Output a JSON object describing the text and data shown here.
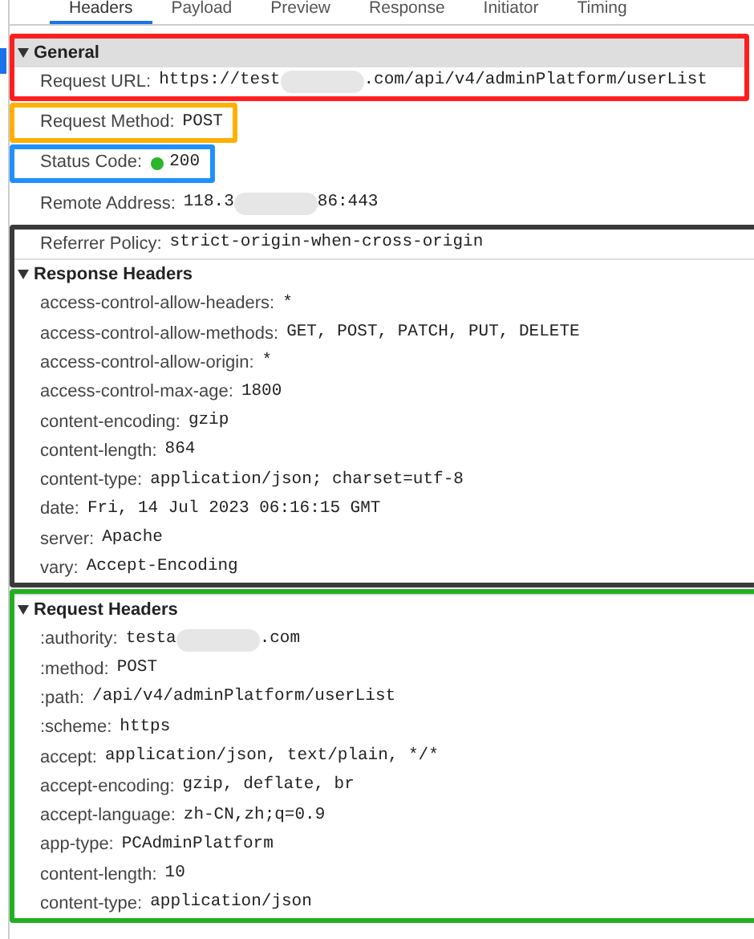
{
  "tabs": [
    {
      "label": "Headers",
      "selected": true
    },
    {
      "label": "Payload",
      "selected": false
    },
    {
      "label": "Preview",
      "selected": false
    },
    {
      "label": "Response",
      "selected": false
    },
    {
      "label": "Initiator",
      "selected": false
    },
    {
      "label": "Timing",
      "selected": false
    }
  ],
  "blocks": [
    {
      "color": "#ff1f1f",
      "lines": [
        {
          "kind": "section",
          "title": "General",
          "expanded": true,
          "highlighted": true
        },
        {
          "kind": "header",
          "name": "Request URL:",
          "value": "https://test",
          "redacted": true,
          "value_after": ".com/api/v4/adminPlatform/userList"
        }
      ]
    },
    {
      "color": "#ffb000",
      "lines": [
        {
          "kind": "header",
          "name": "Request Method:",
          "value": "POST"
        }
      ]
    },
    {
      "color": "#1e90ff",
      "lines": [
        {
          "kind": "status",
          "name": "Status Code:",
          "color": "#2ab52a",
          "value": "200"
        }
      ]
    },
    {
      "lines": [
        {
          "kind": "header",
          "name": "Remote Address:",
          "value": "118.3",
          "redacted": true,
          "value_after": "86:443"
        }
      ]
    },
    {
      "color": "#3a3a3a",
      "lines": [
        {
          "kind": "header",
          "name": "Referrer Policy:",
          "value": "strict-origin-when-cross-origin"
        },
        {
          "kind": "section",
          "title": "Response Headers",
          "expanded": true,
          "highlighted": false
        },
        {
          "kind": "header",
          "name": "access-control-allow-headers:",
          "value": "*"
        },
        {
          "kind": "header",
          "name": "access-control-allow-methods:",
          "value": "GET, POST, PATCH, PUT, DELETE"
        },
        {
          "kind": "header",
          "name": "access-control-allow-origin:",
          "value": "*"
        },
        {
          "kind": "header",
          "name": "access-control-max-age:",
          "value": "1800"
        },
        {
          "kind": "header",
          "name": "content-encoding:",
          "value": "gzip"
        },
        {
          "kind": "header",
          "name": "content-length:",
          "value": "864"
        },
        {
          "kind": "header",
          "name": "content-type:",
          "value": "application/json; charset=utf-8"
        },
        {
          "kind": "header",
          "name": "date:",
          "value": "Fri, 14 Jul 2023 06:16:15 GMT"
        },
        {
          "kind": "header",
          "name": "server:",
          "value": "Apache"
        },
        {
          "kind": "header",
          "name": "vary:",
          "value": "Accept-Encoding"
        }
      ]
    },
    {
      "color": "#22b022",
      "lines": [
        {
          "kind": "section",
          "title": "Request Headers",
          "expanded": true,
          "highlighted": false
        },
        {
          "kind": "header",
          "name": ":authority:",
          "value": "testa",
          "redacted": true,
          "value_after": ".com"
        },
        {
          "kind": "header",
          "name": ":method:",
          "value": "POST"
        },
        {
          "kind": "header",
          "name": ":path:",
          "value": "/api/v4/adminPlatform/userList"
        },
        {
          "kind": "header",
          "name": ":scheme:",
          "value": "https"
        },
        {
          "kind": "header",
          "name": "accept:",
          "value": "application/json, text/plain, */*"
        },
        {
          "kind": "header",
          "name": "accept-encoding:",
          "value": "gzip, deflate, br"
        },
        {
          "kind": "header",
          "name": "accept-language:",
          "value": "zh-CN,zh;q=0.9"
        },
        {
          "kind": "header",
          "name": "app-type:",
          "value": "PCAdminPlatform"
        },
        {
          "kind": "header",
          "name": "content-length:",
          "value": "10"
        },
        {
          "kind": "header",
          "name": "content-type:",
          "value": "application/json"
        }
      ]
    }
  ]
}
